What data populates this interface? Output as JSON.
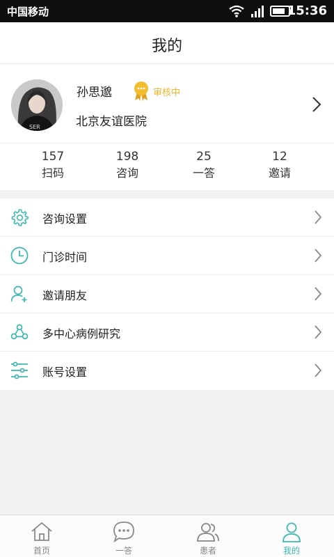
{
  "status_bar": {
    "carrier": "中国移动",
    "time": "15:36"
  },
  "header": {
    "title": "我的"
  },
  "profile": {
    "name": "孙思邈",
    "badge": "审核中",
    "hospital": "北京友谊医院"
  },
  "stats": [
    {
      "value": "157",
      "label": "扫码"
    },
    {
      "value": "198",
      "label": "咨询"
    },
    {
      "value": "25",
      "label": "一答"
    },
    {
      "value": "12",
      "label": "邀请"
    }
  ],
  "menu": [
    {
      "label": "咨询设置",
      "icon": "gear-icon"
    },
    {
      "label": "门诊时间",
      "icon": "clock-icon"
    },
    {
      "label": "邀请朋友",
      "icon": "add-user-icon"
    },
    {
      "label": "多中心病例研究",
      "icon": "network-icon"
    },
    {
      "label": "账号设置",
      "icon": "sliders-icon"
    }
  ],
  "tabs": [
    {
      "label": "首页",
      "icon": "home-icon",
      "active": false
    },
    {
      "label": "一答",
      "icon": "chat-icon",
      "active": false
    },
    {
      "label": "患者",
      "icon": "patients-icon",
      "active": false
    },
    {
      "label": "我的",
      "icon": "person-icon",
      "active": true
    }
  ],
  "colors": {
    "accent": "#3db8b0",
    "badge": "#f0b52c",
    "background": "#f2f2f5"
  }
}
